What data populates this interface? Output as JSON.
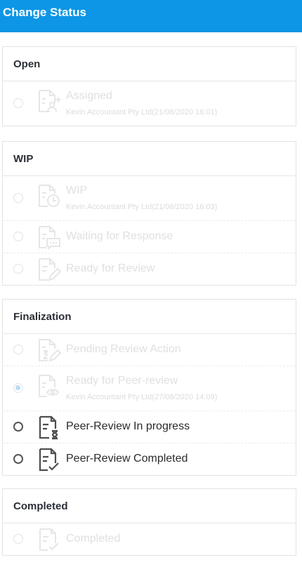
{
  "header": {
    "title": "Change Status"
  },
  "groups": [
    {
      "title": "Open",
      "items": [
        {
          "label": "Assigned",
          "sub": "Kevin Accountant Pty Ltd(21/08/2020 16:01)",
          "icon": "assign-user-document-icon",
          "enabled": false,
          "selected": false
        }
      ]
    },
    {
      "title": "WIP",
      "items": [
        {
          "label": "WIP",
          "sub": "Kevin Accountant Pty Ltd(21/08/2020 16:03)",
          "icon": "clock-document-icon",
          "enabled": false,
          "selected": false
        },
        {
          "label": "Waiting for Response",
          "sub": "",
          "icon": "chat-document-icon",
          "enabled": false,
          "selected": false
        },
        {
          "label": "Ready for Review",
          "sub": "",
          "icon": "pencil-document-icon",
          "enabled": false,
          "selected": false
        }
      ]
    },
    {
      "title": "Finalization",
      "items": [
        {
          "label": "Pending Review Action",
          "sub": "",
          "icon": "hourglass-pencil-document-icon",
          "enabled": false,
          "selected": false
        },
        {
          "label": "Ready for Peer-review",
          "sub": "Kevin Accountant Pty Ltd(27/08/2020 14:09)",
          "icon": "eye-document-icon",
          "enabled": false,
          "selected": true
        },
        {
          "label": "Peer-Review In progress",
          "sub": "",
          "icon": "hourglass-document-icon",
          "enabled": true,
          "selected": false
        },
        {
          "label": "Peer-Review Completed",
          "sub": "",
          "icon": "check-document-icon",
          "enabled": true,
          "selected": false
        }
      ]
    },
    {
      "title": "Completed",
      "items": [
        {
          "label": "Completed",
          "sub": "",
          "icon": "check-document-icon",
          "enabled": false,
          "selected": false
        }
      ]
    }
  ]
}
